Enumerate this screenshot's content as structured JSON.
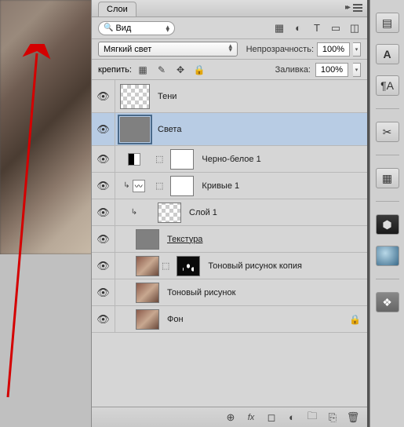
{
  "panel": {
    "title": "Слои"
  },
  "filter": {
    "mode": "Вид"
  },
  "blend": {
    "mode": "Мягкий свет",
    "opacity_label": "Непрозрачность:",
    "opacity": "100%"
  },
  "lock": {
    "label": "крепить:",
    "fill_label": "Заливка:",
    "fill": "100%"
  },
  "layers": [
    {
      "name": "Тени"
    },
    {
      "name": "Света"
    },
    {
      "name": "Черно-белое 1"
    },
    {
      "name": "Кривые 1"
    },
    {
      "name": "Слой 1"
    },
    {
      "name": "Текстура"
    },
    {
      "name": "Тоновый рисунок копия"
    },
    {
      "name": "Тоновый рисунок"
    },
    {
      "name": "Фон"
    }
  ]
}
